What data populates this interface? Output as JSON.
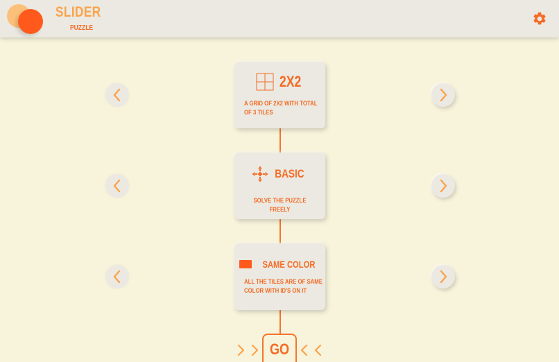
{
  "app": {
    "title": "SLIDER",
    "subtitle": "PUZZLE"
  },
  "header": {
    "settings_icon": "gear-icon"
  },
  "modes": [
    {
      "title": "2X2",
      "description": "A GRID OF 2X2 WITH TOTAL OF 3 TILES",
      "icon": "grid-icon"
    },
    {
      "title": "BASIC",
      "description": "SOLVE THE PUZZLE FREELY",
      "icon": "arrows-cross-icon"
    },
    {
      "title": "SAME COLOR",
      "description": "ALL THE TILES ARE OF SAME COLOR WITH ID'S ON IT",
      "icon": "color-swatch-icon"
    }
  ],
  "go": {
    "label": "GO"
  },
  "colors": {
    "background": "#f8f4dc",
    "surface": "#ebe9e2",
    "accent": "#f46b24",
    "accent_light": "#fba34c"
  }
}
